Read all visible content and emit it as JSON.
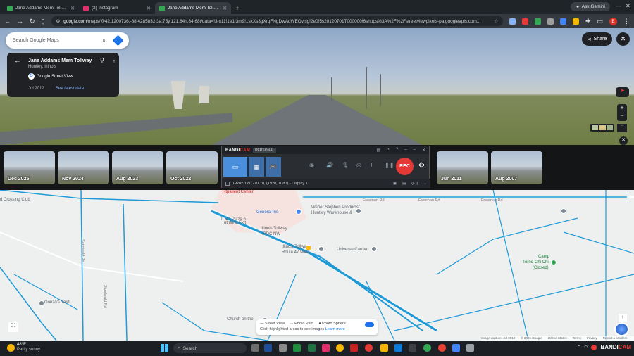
{
  "browser": {
    "tabs": [
      {
        "title": "Jane Addams Mem Tollway - G",
        "favicon_color": "#34a853",
        "active": false
      },
      {
        "title": "(2) Instagram",
        "favicon_color": "#e1306c",
        "active": false
      },
      {
        "title": "Jane Addams Mem Tollway - G",
        "favicon_color": "#34a853",
        "active": true
      }
    ],
    "new_tab": "+",
    "ask_gemini": "Ask Gemini",
    "url_domain": "google.com",
    "url_rest": "/maps/@42.1200736,-88.4285832,3a,75y,121.84h,84.68t/data=!3m11!1e1!3m9!1sxXs3gXrqFNgDwAqWEOvjsg!2e0!5s20120701T000000!6shttps%3A%2F%2Fstreetviewpixels-pa.googleapis.com...",
    "profile_letter": "E"
  },
  "search": {
    "placeholder": "Search Google Maps"
  },
  "street_view_card": {
    "title": "Jane Addams Mem Tollway",
    "location": "Huntley, Illinois",
    "source": "Google Street View",
    "date": "Jul 2012",
    "latest_link": "See latest date"
  },
  "share": {
    "label": "Share"
  },
  "timeline": {
    "items": [
      {
        "date": "Dec 2025"
      },
      {
        "date": "Nov 2024"
      },
      {
        "date": "Aug 2023"
      },
      {
        "date": "Oct 2022"
      },
      {
        "date": "Jun 2011"
      },
      {
        "date": "Aug 2007"
      }
    ]
  },
  "bandicam": {
    "logo_a": "BANDI",
    "logo_b": "CAM",
    "edition": "PERSONAL",
    "rec_label": "REC",
    "mode_text": "1920x1080 - (0, 0), (1920, 1080) - Display 1"
  },
  "map": {
    "labels": [
      {
        "text": "d Crossing Club",
        "cls": ""
      },
      {
        "text": "Freeman Rd",
        "cls": "rd"
      },
      {
        "text": "Freeman Rd",
        "cls": "rd"
      },
      {
        "text": "Freeman Rd",
        "cls": "rd"
      },
      {
        "text": "Weber Stephen Products/",
        "cls": ""
      },
      {
        "text": "Huntley Warehouse &",
        "cls": ""
      },
      {
        "text": "General Ins",
        "cls": "blue"
      },
      {
        "text": "uthfield Exit",
        "cls": ""
      },
      {
        "text": "IL 47 Plaza 6",
        "cls": ""
      },
      {
        "text": "Illinois Tollway",
        "cls": ""
      },
      {
        "text": "IPDC NW",
        "cls": ""
      },
      {
        "text": "Illinois Tollway",
        "cls": ""
      },
      {
        "text": "Route 47 West",
        "cls": ""
      },
      {
        "text": "Universe Carrier",
        "cls": ""
      },
      {
        "text": "Camp",
        "cls": "green"
      },
      {
        "text": "Torno-Chi Chi",
        "cls": "green"
      },
      {
        "text": "(Closed)",
        "cls": "green"
      },
      {
        "text": "Gonzo's Yard",
        "cls": ""
      },
      {
        "text": "Church on the",
        "cls": ""
      },
      {
        "text": "Sandwald Rd",
        "cls": "rd"
      },
      {
        "text": "Sandwald Rd",
        "cls": "rd"
      },
      {
        "text": "Rtpatient Center",
        "cls": "red"
      }
    ],
    "legend": {
      "street_view": "Street View",
      "photo_path": "Photo Path",
      "photo_sphere": "Photo Sphere",
      "hint": "Click highlighted areas to see images",
      "learn_more": "Learn more"
    },
    "attribution": [
      "Image capture: Jul 2012",
      "© 2026 Google",
      "United States",
      "Terms",
      "Privacy",
      "Report a problem"
    ]
  },
  "taskbar": {
    "temp": "48°F",
    "weather": "Partly sunny",
    "weather_badge": "1",
    "search_placeholder": "Search",
    "tray_brand_a": "BANDI",
    "tray_brand_b": "CAM"
  }
}
